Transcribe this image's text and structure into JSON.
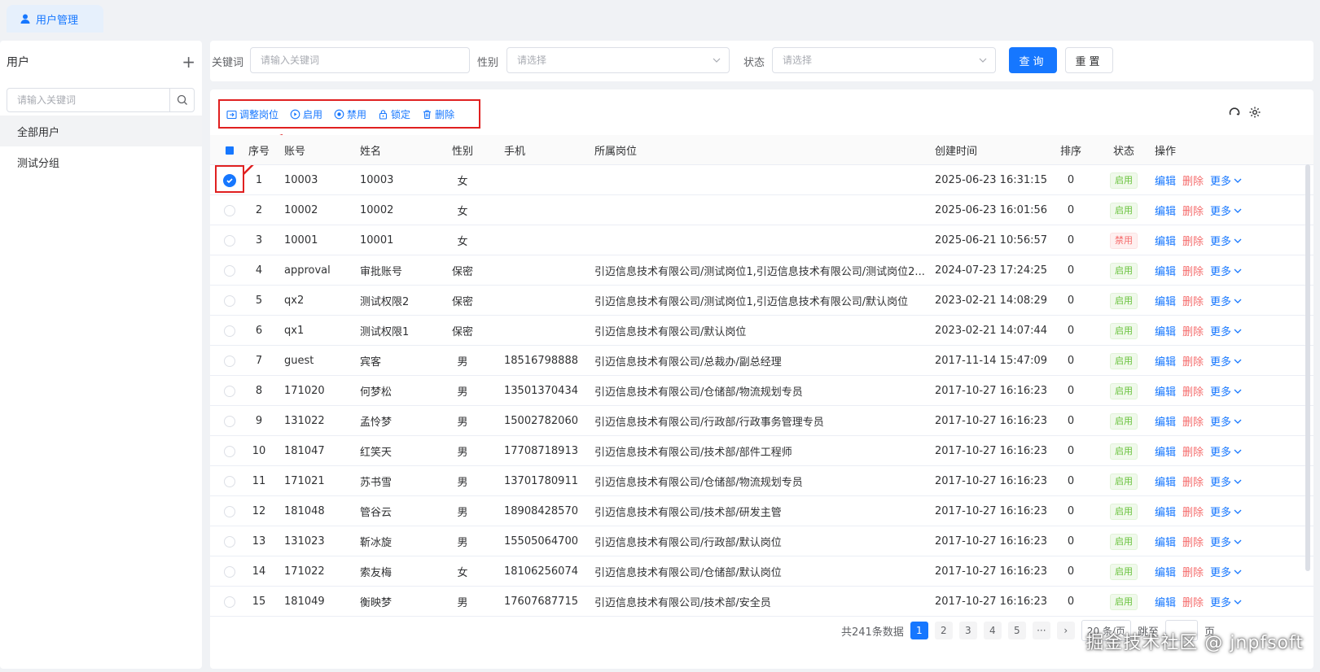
{
  "tabs": [
    {
      "label": "用户管理",
      "active": true
    }
  ],
  "sidebar": {
    "title": "用户",
    "add_icon": "plus-icon",
    "search_placeholder": "请输入关键词",
    "items": [
      {
        "label": "全部用户",
        "active": true
      },
      {
        "label": "测试分组",
        "active": false
      }
    ]
  },
  "filters": {
    "keyword_label": "关键词",
    "keyword_placeholder": "请输入关键词",
    "gender_label": "性别",
    "gender_placeholder": "请选择",
    "status_label": "状态",
    "status_placeholder": "请选择",
    "query_label": "查询",
    "reset_label": "重置"
  },
  "toolbar": {
    "adjust_label": "调整岗位",
    "enable_label": "启用",
    "disable_label": "禁用",
    "lock_label": "锁定",
    "delete_label": "删除"
  },
  "table": {
    "headers": {
      "seq": "序号",
      "account": "账号",
      "name": "姓名",
      "gender": "性别",
      "phone": "手机",
      "post": "所属岗位",
      "created": "创建时间",
      "sort": "排序",
      "status": "状态",
      "ops": "操作"
    },
    "ops": {
      "edit": "编辑",
      "delete": "删除",
      "more": "更多"
    },
    "rows": [
      {
        "seq": "1",
        "account": "10003",
        "name": "10003",
        "gender": "女",
        "phone": "",
        "post": "",
        "created": "2025-06-23 16:31:15",
        "sort": "0",
        "status": "启用",
        "checked": true
      },
      {
        "seq": "2",
        "account": "10002",
        "name": "10002",
        "gender": "女",
        "phone": "",
        "post": "",
        "created": "2025-06-23 16:01:56",
        "sort": "0",
        "status": "启用"
      },
      {
        "seq": "3",
        "account": "10001",
        "name": "10001",
        "gender": "女",
        "phone": "",
        "post": "",
        "created": "2025-06-21 10:56:57",
        "sort": "0",
        "status": "禁用"
      },
      {
        "seq": "4",
        "account": "approval",
        "name": "审批账号",
        "gender": "保密",
        "phone": "",
        "post": "引迈信息技术有限公司/测试岗位1,引迈信息技术有限公司/测试岗位2...",
        "created": "2024-07-23 17:24:25",
        "sort": "0",
        "status": "启用"
      },
      {
        "seq": "5",
        "account": "qx2",
        "name": "测试权限2",
        "gender": "保密",
        "phone": "",
        "post": "引迈信息技术有限公司/测试岗位1,引迈信息技术有限公司/默认岗位",
        "created": "2023-02-21 14:08:29",
        "sort": "0",
        "status": "启用"
      },
      {
        "seq": "6",
        "account": "qx1",
        "name": "测试权限1",
        "gender": "保密",
        "phone": "",
        "post": "引迈信息技术有限公司/默认岗位",
        "created": "2023-02-21 14:07:44",
        "sort": "0",
        "status": "启用"
      },
      {
        "seq": "7",
        "account": "guest",
        "name": "宾客",
        "gender": "男",
        "phone": "18516798888",
        "post": "引迈信息技术有限公司/总裁办/副总经理",
        "created": "2017-11-14 15:47:09",
        "sort": "0",
        "status": "启用"
      },
      {
        "seq": "8",
        "account": "171020",
        "name": "何梦松",
        "gender": "男",
        "phone": "13501370434",
        "post": "引迈信息技术有限公司/仓储部/物流规划专员",
        "created": "2017-10-27 16:16:23",
        "sort": "0",
        "status": "启用"
      },
      {
        "seq": "9",
        "account": "131022",
        "name": "孟怜梦",
        "gender": "男",
        "phone": "15002782060",
        "post": "引迈信息技术有限公司/行政部/行政事务管理专员",
        "created": "2017-10-27 16:16:23",
        "sort": "0",
        "status": "启用"
      },
      {
        "seq": "10",
        "account": "181047",
        "name": "红笑天",
        "gender": "男",
        "phone": "17708718913",
        "post": "引迈信息技术有限公司/技术部/部件工程师",
        "created": "2017-10-27 16:16:23",
        "sort": "0",
        "status": "启用"
      },
      {
        "seq": "11",
        "account": "171021",
        "name": "苏书雪",
        "gender": "男",
        "phone": "13701780911",
        "post": "引迈信息技术有限公司/仓储部/物流规划专员",
        "created": "2017-10-27 16:16:23",
        "sort": "0",
        "status": "启用"
      },
      {
        "seq": "12",
        "account": "181048",
        "name": "管谷云",
        "gender": "男",
        "phone": "18908428570",
        "post": "引迈信息技术有限公司/技术部/研发主管",
        "created": "2017-10-27 16:16:23",
        "sort": "0",
        "status": "启用"
      },
      {
        "seq": "13",
        "account": "131023",
        "name": "靳冰旋",
        "gender": "男",
        "phone": "15505064700",
        "post": "引迈信息技术有限公司/行政部/默认岗位",
        "created": "2017-10-27 16:16:23",
        "sort": "0",
        "status": "启用"
      },
      {
        "seq": "14",
        "account": "171022",
        "name": "索友梅",
        "gender": "女",
        "phone": "18106256074",
        "post": "引迈信息技术有限公司/仓储部/默认岗位",
        "created": "2017-10-27 16:16:23",
        "sort": "0",
        "status": "启用"
      },
      {
        "seq": "15",
        "account": "181049",
        "name": "衡映梦",
        "gender": "男",
        "phone": "17607687715",
        "post": "引迈信息技术有限公司/技术部/安全员",
        "created": "2017-10-27 16:16:23",
        "sort": "0",
        "status": "启用"
      }
    ]
  },
  "pagination": {
    "total": "共241条数据",
    "pages": [
      "1",
      "2",
      "3",
      "4",
      "5"
    ],
    "page_size": "20 条/页",
    "jump_label": "跳至",
    "page_suffix": "页"
  },
  "watermark": "掘金技术社区 @ jnpfsoft",
  "colors": {
    "primary": "#1677ff",
    "danger": "#f56c6c",
    "success": "#67c23a",
    "highlight": "#e02020"
  }
}
